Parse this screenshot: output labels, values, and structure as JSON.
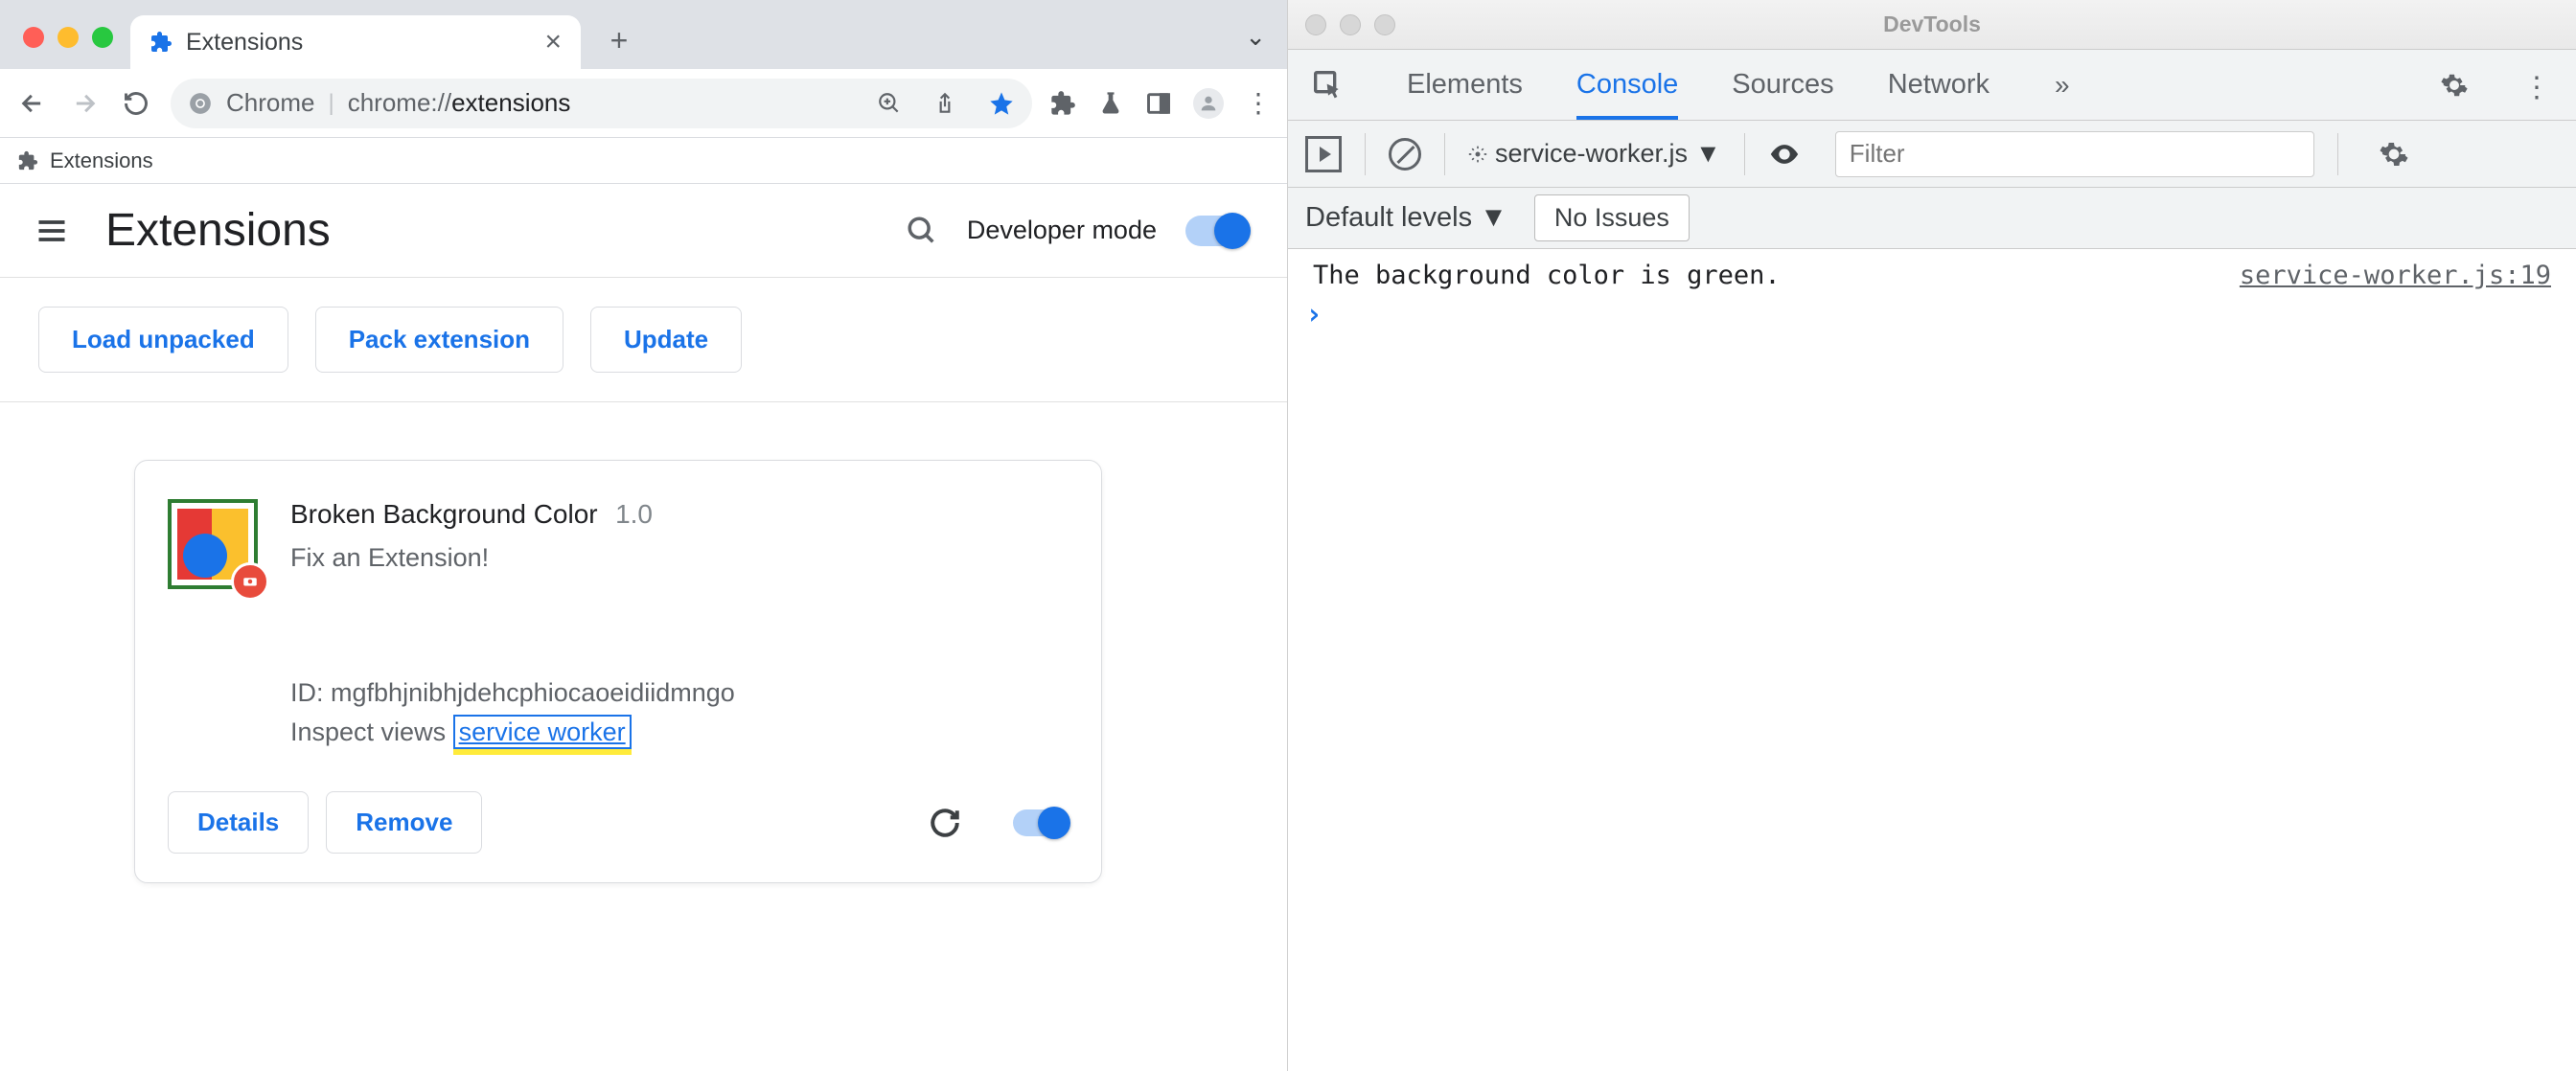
{
  "browser": {
    "tab": {
      "title": "Extensions"
    },
    "omnibox": {
      "label": "Chrome",
      "url_prefix": "chrome://",
      "url_bold": "extensions"
    },
    "bookmarks": [
      {
        "label": "Extensions"
      }
    ],
    "page": {
      "title": "Extensions",
      "devmode_label": "Developer mode",
      "buttons": {
        "load": "Load unpacked",
        "pack": "Pack extension",
        "update": "Update"
      }
    },
    "extension": {
      "name": "Broken Background Color",
      "version": "1.0",
      "description": "Fix an Extension!",
      "id_label": "ID:",
      "id": "mgfbhjnibhjdehcphiocaoeidiidmngo",
      "inspect_label": "Inspect views",
      "inspect_link": "service worker",
      "details": "Details",
      "remove": "Remove"
    }
  },
  "devtools": {
    "window_title": "DevTools",
    "tabs": [
      "Elements",
      "Console",
      "Sources",
      "Network"
    ],
    "active_tab": "Console",
    "context": "service-worker.js",
    "filter_placeholder": "Filter",
    "levels": "Default levels",
    "issues": "No Issues",
    "log": {
      "message": "The background color is green.",
      "source": "service-worker.js:19"
    }
  }
}
